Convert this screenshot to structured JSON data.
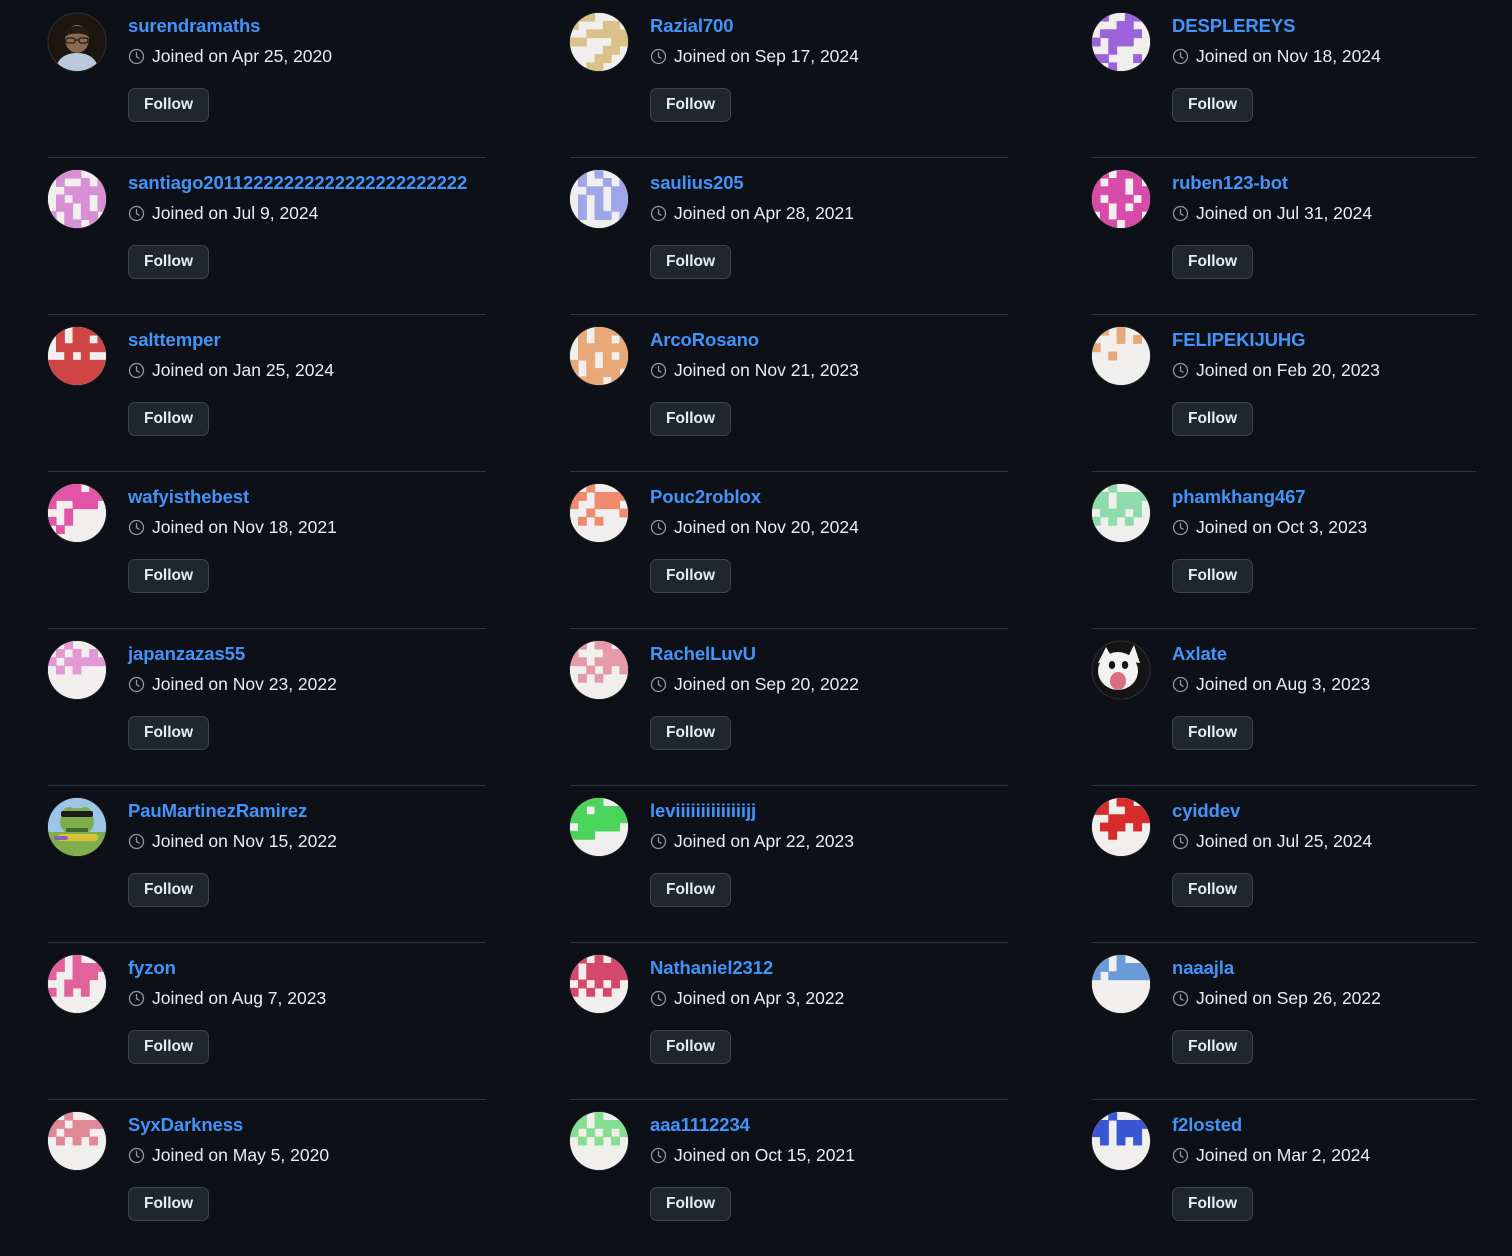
{
  "page": {
    "background_color": "#0d1117",
    "link_color": "#4493f8",
    "text_color": "#e6edf3",
    "divider_color": "#30363d",
    "button_background": "#21262d",
    "button_border": "#3d444d",
    "columns": 3,
    "joined_prefix": "Joined on",
    "follow_label": "Follow",
    "clock_icon": "clock-icon"
  },
  "users": [
    {
      "username": "surendramaths",
      "joined": "Joined on Apr 25, 2020",
      "follow_label": "Follow",
      "avatar_type": "photo",
      "avatar_kind": "person-photo",
      "avatar_colors": [
        "#1b1610",
        "#b8c9dd",
        "#8a6a52"
      ]
    },
    {
      "username": "Razial700",
      "joined": "Joined on Sep 17, 2024",
      "follow_label": "Follow",
      "avatar_type": "identicon",
      "avatar_color": "#d9c187",
      "avatar_bg": "#f0efed",
      "avatar_pattern": "0110001100011000111111100011000011000011000011000"
    },
    {
      "username": "DESPLEREYS",
      "joined": "Joined on Nov 18, 2024",
      "follow_label": "Follow",
      "avatar_type": "identicon",
      "avatar_color": "#9b63d8",
      "avatar_bg": "#f0efed",
      "avatar_pattern": "1100111000110001111101011100001000011000100010001"
    },
    {
      "username": "santiago20112222222222222222222222",
      "joined": "Joined on Jul 9, 2024",
      "follow_label": "Follow",
      "avatar_type": "identicon",
      "avatar_color": "#d98fd6",
      "avatar_bg": "#f0efed",
      "avatar_pattern": "0111001010010100111110101101011010110101101011011"
    },
    {
      "username": "saulius205",
      "joined": "Joined on Apr 28, 2021",
      "follow_label": "Follow",
      "avatar_type": "identicon",
      "avatar_color": "#9fa6e8",
      "avatar_bg": "#f0efed",
      "avatar_pattern": "0101001010010100110110101011010101101011010000000"
    },
    {
      "username": "ruben123-bot",
      "joined": "Joined on Jul 31, 2024",
      "follow_label": "Follow",
      "avatar_type": "identicon",
      "avatar_color": "#d94ba8",
      "avatar_bg": "#f0efed",
      "avatar_pattern": "1101110101101011110111011101110101101011101110111"
    },
    {
      "username": "salttemper",
      "joined": "Joined on Jan 25, 2024",
      "follow_label": "Follow",
      "avatar_type": "identicon",
      "avatar_color": "#cf4444",
      "avatar_bg": "#f0efed",
      "avatar_pattern": "1101111010110101111110010100111111111111111111111"
    },
    {
      "username": "ArcoRosano",
      "joined": "Joined on Nov 21, 2023",
      "follow_label": "Follow",
      "avatar_type": "identicon",
      "avatar_color": "#e8a878",
      "avatar_bg": "#f0efed",
      "avatar_pattern": "1101111010110101111110110101101011110111101111011"
    },
    {
      "username": "FELIPEKIJUHG",
      "joined": "Joined on Feb 20, 2023",
      "follow_label": "Follow",
      "avatar_type": "identicon",
      "avatar_color": "#e8a878",
      "avatar_bg": "#f0efed",
      "avatar_pattern": "0101000000101010000000010000000000000000000000000"
    },
    {
      "username": "wafyisthebest",
      "joined": "Joined on Nov 18, 2021",
      "follow_label": "Follow",
      "avatar_type": "identicon",
      "avatar_color": "#e254a8",
      "avatar_bg": "#f0efed",
      "avatar_pattern": "0111011111111110011100010000101000001000000000000"
    },
    {
      "username": "Pouc2roblox",
      "joined": "Joined on Nov 20, 2024",
      "follow_label": "Follow",
      "avatar_type": "identicon",
      "avatar_color": "#ef8a6e",
      "avatar_bg": "#f0efed",
      "avatar_pattern": "0010001110111110011100010001010100000000000000000"
    },
    {
      "username": "phamkhang467",
      "joined": "Joined on Oct 3, 2023",
      "follow_label": "Follow",
      "avatar_type": "identicon",
      "avatar_color": "#8edcab",
      "avatar_bg": "#f0efed",
      "avatar_pattern": "0010001110111111011100111010101010000000000000000"
    },
    {
      "username": "japanzazas55",
      "joined": "Joined on Nov 23, 2022",
      "follow_label": "Follow",
      "avatar_type": "identicon",
      "avatar_color": "#e397d5",
      "avatar_bg": "#f0efed",
      "avatar_pattern": "0010001010101010111110101000000000000000000000000"
    },
    {
      "username": "RachelLuvU",
      "joined": "Joined on Sep 20, 2022",
      "follow_label": "Follow",
      "avatar_type": "identicon",
      "avatar_color": "#e49aa8",
      "avatar_bg": "#f0efed",
      "avatar_pattern": "1101100100011111011110010101010100000000000000000"
    },
    {
      "username": "Axlate",
      "joined": "Joined on Aug 3, 2023",
      "follow_label": "Follow",
      "avatar_type": "photo",
      "avatar_kind": "cat-photo",
      "avatar_colors": [
        "#141414",
        "#f2f2f2",
        "#d9707e"
      ]
    },
    {
      "username": "PauMartinezRamirez",
      "joined": "Joined on Nov 15, 2022",
      "follow_label": "Follow",
      "avatar_type": "photo",
      "avatar_kind": "frog-photo",
      "avatar_colors": [
        "#7fae4a",
        "#3f6b2b",
        "#9ec5e8",
        "#d9c23a"
      ]
    },
    {
      "username": "leviiiiiiiiiiiiiijj",
      "joined": "Joined on Apr 22, 2023",
      "follow_label": "Follow",
      "avatar_type": "identicon",
      "avatar_color": "#4bd45c",
      "avatar_bg": "#f0efed",
      "avatar_pattern": "0111001110111111111110111110111000000000000000000"
    },
    {
      "username": "cyiddev",
      "joined": "Joined on Jul 25, 2024",
      "follow_label": "Follow",
      "avatar_type": "identicon",
      "avatar_color": "#d82c2c",
      "avatar_bg": "#f0efed",
      "avatar_pattern": "1101101110011100111110111010001000000000000000000"
    },
    {
      "username": "fyzon",
      "joined": "Joined on Aug 7, 2023",
      "follow_label": "Follow",
      "avatar_type": "identicon",
      "avatar_color": "#e2629c",
      "avatar_bg": "#f0efed",
      "avatar_pattern": "0101001110111110011100011100101010000000000000000"
    },
    {
      "username": "Nathaniel2312",
      "joined": "Joined on Apr 3, 2022",
      "follow_label": "Follow",
      "avatar_type": "identicon",
      "avatar_color": "#d4496b",
      "avatar_bg": "#f0efed",
      "avatar_pattern": "0101010101111110111110101010101010000000000000000"
    },
    {
      "username": "naaajla",
      "joined": "Joined on Sep 26, 2022",
      "follow_label": "Follow",
      "avatar_type": "identicon",
      "avatar_color": "#6a9bd8",
      "avatar_bg": "#f0efed",
      "avatar_pattern": "0101001110111110111110000000000000000000000000000"
    },
    {
      "username": "SyxDarkness",
      "joined": "Joined on May 5, 2020",
      "follow_label": "Follow",
      "avatar_type": "identicon",
      "avatar_color": "#e08898",
      "avatar_bg": "#f0efed",
      "avatar_pattern": "0010001110111110111000101010000000000000000000000"
    },
    {
      "username": "aaa1112234",
      "joined": "Joined on Oct 15, 2021",
      "follow_label": "Follow",
      "avatar_type": "identicon",
      "avatar_color": "#86de92",
      "avatar_bg": "#f0efed",
      "avatar_pattern": "0101001110111110101010101010000000000000000000000"
    },
    {
      "username": "f2losted",
      "joined": "Joined on Mar 2, 2024",
      "follow_label": "Follow",
      "avatar_type": "identicon",
      "avatar_color": "#3b56d4",
      "avatar_bg": "#f0efed",
      "avatar_pattern": "0010001110111111011100101010000000000000000000000"
    }
  ]
}
